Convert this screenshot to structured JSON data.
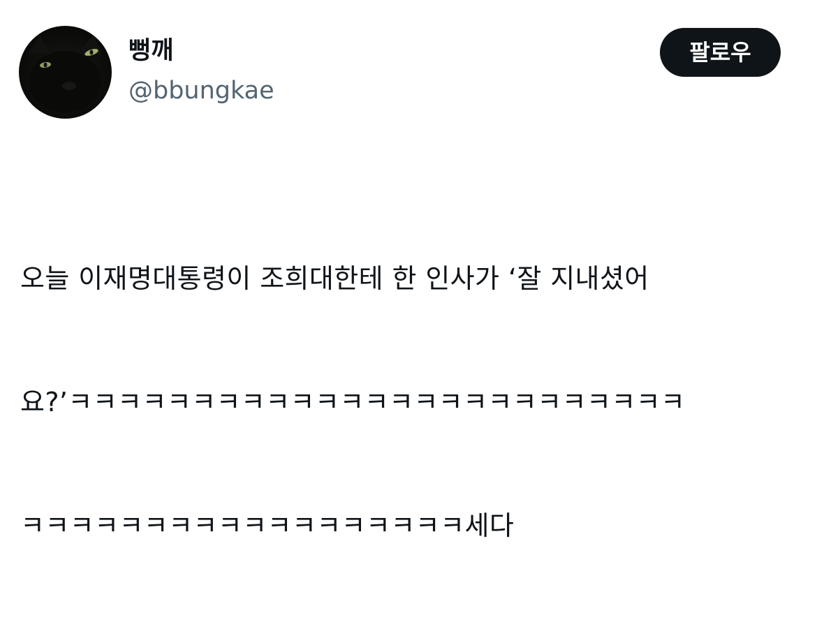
{
  "author": {
    "display_name": "뻥깨",
    "handle": "@bbungkae",
    "avatar_icon": "black-cat-avatar"
  },
  "follow_button": {
    "label": "팔로우",
    "bg_color": "#0f1419",
    "text_color": "#ffffff"
  },
  "tweet": {
    "text": "오늘 이재명대통령이 조희대한테 한 인사가 ‘잘 지내셨어요?’ㅋㅋㅋㅋㅋㅋㅋㅋㅋㅋㅋㅋㅋㅋㅋㅋㅋㅋㅋㅋㅋㅋㅋㅋㅋㅋㅋㅋㅋㅋㅋㅋㅋㅋㅋㅋㅋㅋㅋㅋㅋㅋㅋ세다",
    "lines": [
      "오늘 이재명대통령이 조희대한테 한 인사가 ‘잘 지내셨어",
      "요?’ㅋㅋㅋㅋㅋㅋㅋㅋㅋㅋㅋㅋㅋㅋㅋㅋㅋㅋㅋㅋㅋㅋㅋㅋㅋ",
      "ㅋㅋㅋㅋㅋㅋㅋㅋㅋㅋㅋㅋㅋㅋㅋㅋㅋㅋ세다"
    ]
  },
  "colors": {
    "primary_text": "#0f1419",
    "secondary_text": "#536471",
    "background": "#ffffff"
  }
}
